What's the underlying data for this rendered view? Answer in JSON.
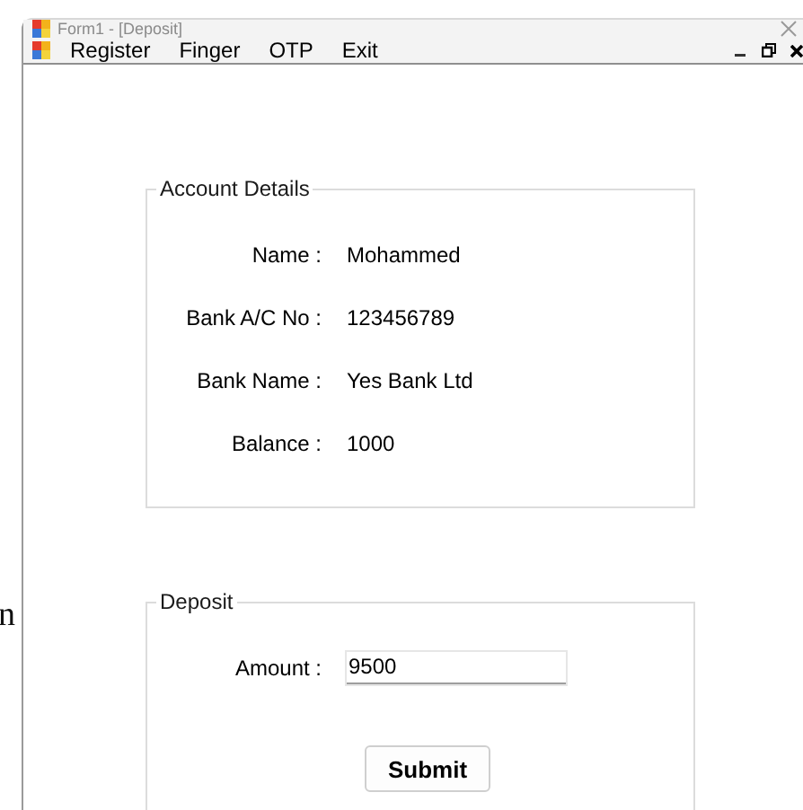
{
  "background_text": "n",
  "window": {
    "title": "Form1 - [Deposit]"
  },
  "menu": [
    {
      "label": "Register"
    },
    {
      "label": "Finger"
    },
    {
      "label": "OTP"
    },
    {
      "label": "Exit"
    }
  ],
  "account_details": {
    "title": "Account Details",
    "fields": [
      {
        "label": "Name :",
        "value": "Mohammed"
      },
      {
        "label": "Bank A/C No :",
        "value": "123456789"
      },
      {
        "label": "Bank Name :",
        "value": "Yes Bank Ltd"
      },
      {
        "label": "Balance :",
        "value": "1000"
      }
    ]
  },
  "deposit": {
    "title": "Deposit",
    "amount_label": "Amount :",
    "amount_value": "9500",
    "submit": "Submit"
  }
}
